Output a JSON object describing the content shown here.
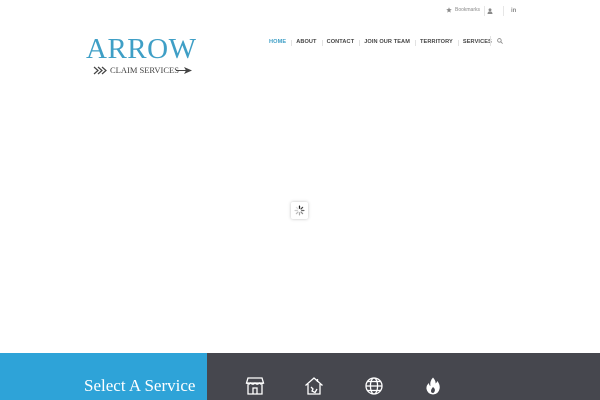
{
  "topbar": {
    "bookmarks_label": "Bookmarks",
    "linkedin_label": "in"
  },
  "logo": {
    "wordmark": "ARROW",
    "subtitle": "CLAIM SERVICES"
  },
  "nav": {
    "items": [
      {
        "label": "HOME",
        "active": true
      },
      {
        "label": "ABOUT",
        "active": false
      },
      {
        "label": "CONTACT",
        "active": false
      },
      {
        "label": "JOIN OUR TEAM",
        "active": false
      },
      {
        "label": "TERRITORY",
        "active": false
      },
      {
        "label": "SERVICES",
        "active": false
      }
    ]
  },
  "services": {
    "title": "Select A Service",
    "icons": [
      "storefront-icon",
      "house-damage-icon",
      "globe-icon",
      "fire-icon"
    ]
  },
  "colors": {
    "brand_blue": "#3f9fc6",
    "band_blue": "#2ea3d8",
    "band_dark": "#46474e"
  },
  "icons": {
    "bookmarks": "star-icon",
    "account": "user-icon",
    "search": "search-icon",
    "loading": "spinner-icon"
  }
}
